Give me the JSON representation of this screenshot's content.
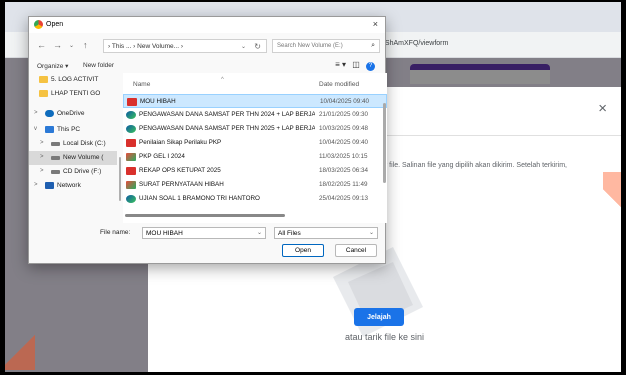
{
  "browser": {
    "url_fragment": "nAvShAmXFQ/viewform"
  },
  "upload_modal": {
    "description": "er file. Salinan file yang dipilih akan dikirim. Setelah terkirim,",
    "browse_label": "Jelajah",
    "drop_text": "atau tarik file ke sini",
    "close_glyph": "×"
  },
  "dialog": {
    "title": "Open",
    "close_glyph": "×",
    "breadcrumb": "› This ... › New Volume... ›",
    "search_placeholder": "Search New Volume (E:)",
    "toolbar": {
      "organize": "Organize ▾",
      "new_folder": "New folder"
    },
    "nav_items": [
      {
        "label": "5. LOG ACTIVIT",
        "icon": "folder-icon"
      },
      {
        "label": "LHAP TENTI GO",
        "icon": "folder-icon"
      },
      {
        "label": "OneDrive",
        "icon": "cloud-icon",
        "chevron": ">"
      },
      {
        "label": "This PC",
        "icon": "pc-icon",
        "chevron": "v"
      },
      {
        "label": "Local Disk (C:)",
        "icon": "disk-icon",
        "chevron": ">"
      },
      {
        "label": "New Volume (",
        "icon": "disk-icon",
        "chevron": ">"
      },
      {
        "label": "CD Drive (F:)",
        "icon": "disk-icon",
        "chevron": ">"
      },
      {
        "label": "Network",
        "icon": "network-icon",
        "chevron": ">"
      }
    ],
    "columns": {
      "name": "Name",
      "date": "Date modified"
    },
    "files": [
      {
        "name": "MOU HIBAH",
        "date": "10/04/2025 09:40",
        "icon": "pdf-icon",
        "selected": true
      },
      {
        "name": "PENGAWASAN DANA SAMSAT PER THN 2024 + LAP BERJAL...",
        "date": "21/01/2025 09:30",
        "icon": "edge-icon"
      },
      {
        "name": "PENGAWASAN DANA SAMSAT PER THN 2025 + LAP BERJAL...",
        "date": "10/03/2025 09:48",
        "icon": "edge-icon"
      },
      {
        "name": "Penilaian Sikap Perilaku PKP",
        "date": "10/04/2025 09:40",
        "icon": "pdf-icon"
      },
      {
        "name": "PKP GEL I 2024",
        "date": "11/03/2025 10:15",
        "icon": "image-icon"
      },
      {
        "name": "REKAP OPS KETUPAT 2025",
        "date": "18/03/2025 06:34",
        "icon": "pdf-icon"
      },
      {
        "name": "SURAT PERNYATAAN HIBAH",
        "date": "18/02/2025 11:49",
        "icon": "image-icon"
      },
      {
        "name": "UJIAN SOAL 1 BRAMONO TRI HANTORO",
        "date": "25/04/2025 09:13",
        "icon": "edge-icon"
      }
    ],
    "filename_label": "File name:",
    "filename_value": "MOU HIBAH",
    "filetype_value": "All Files",
    "open_label": "Open",
    "cancel_label": "Cancel"
  }
}
